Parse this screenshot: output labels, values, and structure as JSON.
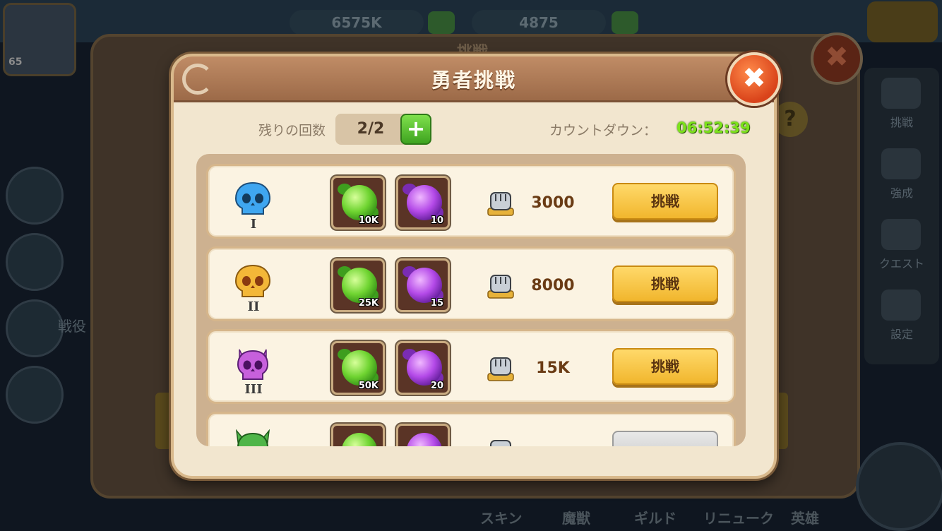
{
  "background": {
    "player_level": "65",
    "gold_amount": "6575K",
    "gem_amount": "4875",
    "panel_title": "挑戦",
    "help_label": "?",
    "close_label": "✖",
    "side_label": "戦役",
    "right_menu": [
      "挑戦",
      "強成",
      "クエスト",
      "設定"
    ],
    "bottom_menu": [
      "スキン",
      "魔獣",
      "ギルド",
      "リニューク",
      "英雄"
    ]
  },
  "modal": {
    "title": "勇者挑戦",
    "close_label": "✖",
    "remaining_label": "残りの回数",
    "remaining_value": "2/2",
    "plus_label": "+",
    "countdown_label": "カウントダウン：",
    "countdown_value": "06:52:39"
  },
  "challenges": [
    {
      "rank": "I",
      "skull_color": "#3fa6f0",
      "green_qty": "10K",
      "purple_qty": "10",
      "power": "3000",
      "button": "挑戦"
    },
    {
      "rank": "II",
      "skull_color": "#f3b738",
      "green_qty": "25K",
      "purple_qty": "15",
      "power": "8000",
      "button": "挑戦"
    },
    {
      "rank": "III",
      "skull_color": "#c760dc",
      "green_qty": "50K",
      "purple_qty": "20",
      "power": "15K",
      "button": "挑戦"
    },
    {
      "rank": "",
      "skull_color": "#4fb548",
      "green_qty": "",
      "purple_qty": "",
      "power": "",
      "button": ""
    }
  ],
  "colors": {
    "accent_green": "#7de21c",
    "button_yellow": "#f1b62d",
    "close_orange": "#d9431a"
  }
}
